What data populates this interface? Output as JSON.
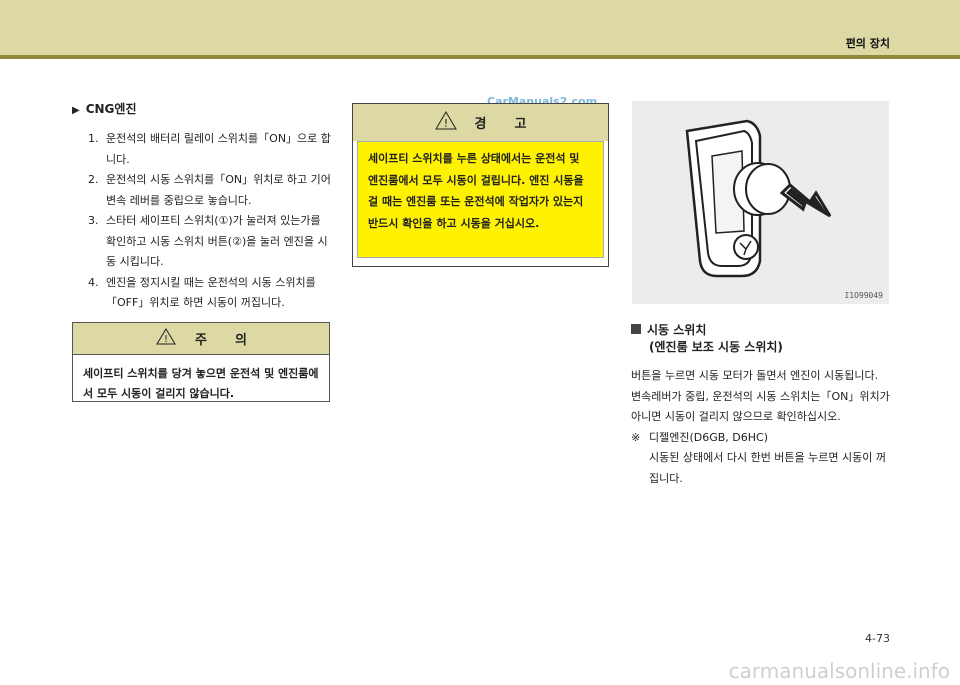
{
  "header": {
    "section_title": "편의 장치"
  },
  "watermark_top": "CarManuals2.com",
  "cng": {
    "heading": "CNG엔진",
    "steps": [
      {
        "num": "1.",
        "text": "운전석의 배터리 릴레이 스위치를「ON」으로 합니다."
      },
      {
        "num": "2.",
        "text": "운전석의 시동 스위치를「ON」위치로 하고 기어 변속 레버를 중립으로 놓습니다."
      },
      {
        "num": "3.",
        "text": "스타터 세이프티 스위치(①)가 눌러져 있는가를 확인하고 시동 스위치 버튼(②)을 눌러 엔진을 시동 시킵니다."
      },
      {
        "num": "4.",
        "text": "엔진을 정지시킬 때는 운전석의 시동 스위치를「OFF」위치로 하면 시동이 꺼집니다."
      }
    ]
  },
  "caution": {
    "title_a": "주",
    "title_b": "의",
    "body": "세이프티 스위치를 당겨 놓으면 운전석 및 엔진룸에서 모두 시동이 걸리지 않습니다."
  },
  "warning": {
    "title_a": "경",
    "title_b": "고",
    "body": "세이프티 스위치를 누른 상태에서는 운전석 및 엔진룸에서 모두 시동이 걸립니다. 엔진 시동을 걸 때는 엔진룸 또는 운전석에 작업자가 있는지 반드시 확인을 하고 시동을 거십시오."
  },
  "figure": {
    "code": "I1O99049",
    "icon": "start-button-illustration"
  },
  "start_switch": {
    "heading": "시동 스위치",
    "subheading": "(엔진룸 보조 시동 스위치)",
    "para1": "버튼을 누르면 시동 모터가 돌면서 엔진이 시동됩니다.",
    "para2": "변속레버가 중립, 운전석의 시동 스위치는「ON」위치가 아니면 시동이 걸리지 않으므로 확인하십시오.",
    "note_mark": "※",
    "note_title": "디젤엔진(D6GB, D6HC)",
    "note_body": "시동된 상태에서 다시 한번 버튼을 누르면 시동이 꺼집니다."
  },
  "page_number": "4-73",
  "footer_watermark": "carmanualsonline.info"
}
